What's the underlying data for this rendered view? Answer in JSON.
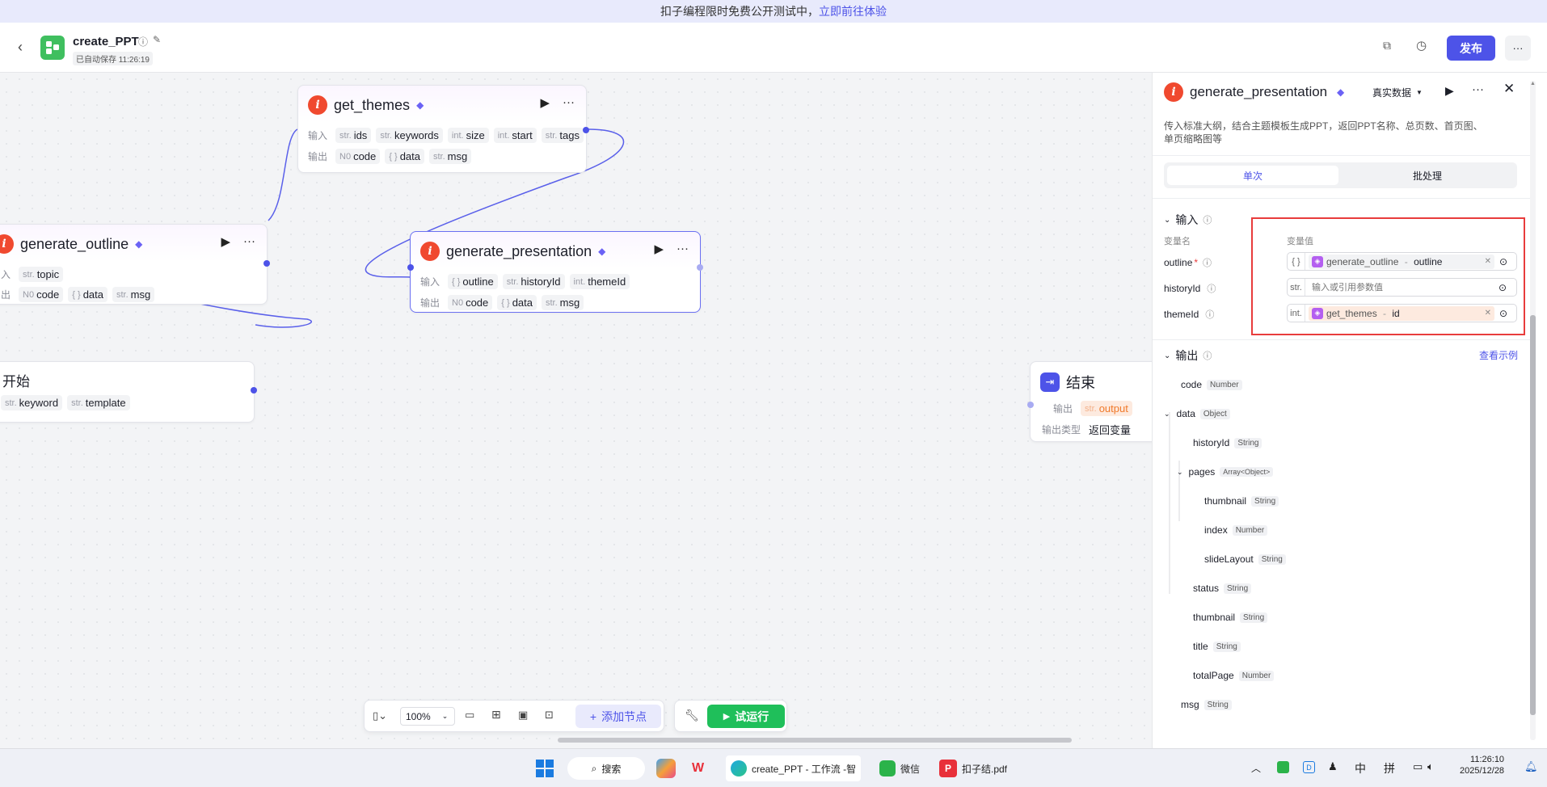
{
  "banner": {
    "text": "扣子编程限时免费公开测试中，",
    "link": "立即前往体验"
  },
  "header": {
    "title": "create_PPT",
    "autosave": "已自动保存 11:26:19",
    "publish_label": "发布",
    "more_label": "···"
  },
  "nodes": {
    "get_themes": {
      "title": "get_themes",
      "input_label": "输入",
      "output_label": "输出",
      "inputs": [
        {
          "type": "str.",
          "name": "ids"
        },
        {
          "type": "str.",
          "name": "keywords"
        },
        {
          "type": "int.",
          "name": "size"
        },
        {
          "type": "int.",
          "name": "start"
        },
        {
          "type": "str.",
          "name": "tags"
        }
      ],
      "outputs": [
        {
          "type": "N0",
          "name": "code"
        },
        {
          "type": "{ }",
          "name": "data"
        },
        {
          "type": "str.",
          "name": "msg"
        }
      ]
    },
    "generate_outline": {
      "title": "generate_outline",
      "input_label": "入",
      "output_label": "出",
      "inputs": [
        {
          "type": "str.",
          "name": "topic"
        }
      ],
      "outputs": [
        {
          "type": "N0",
          "name": "code"
        },
        {
          "type": "{ }",
          "name": "data"
        },
        {
          "type": "str.",
          "name": "msg"
        }
      ]
    },
    "generate_presentation": {
      "title": "generate_presentation",
      "input_label": "输入",
      "output_label": "输出",
      "inputs": [
        {
          "type": "{ }",
          "name": "outline"
        },
        {
          "type": "str.",
          "name": "historyId"
        },
        {
          "type": "int.",
          "name": "themeId"
        }
      ],
      "outputs": [
        {
          "type": "N0",
          "name": "code"
        },
        {
          "type": "{ }",
          "name": "data"
        },
        {
          "type": "str.",
          "name": "msg"
        }
      ]
    },
    "start": {
      "title": "开始",
      "outputs": [
        {
          "type": "str.",
          "name": "keyword"
        },
        {
          "type": "str.",
          "name": "template"
        }
      ]
    },
    "end": {
      "title": "结束",
      "output_label": "输出",
      "output_var": {
        "type": "str.",
        "name": "output"
      },
      "output_type_label": "输出类型",
      "output_type_value": "返回变量"
    }
  },
  "toolbar": {
    "zoom": "100%",
    "add_node_label": "添加节点",
    "test_run_label": "试运行"
  },
  "panel": {
    "title": "generate_presentation",
    "data_mode": "真实数据",
    "description": "传入标准大纲，结合主题模板生成PPT，返回PPT名称、总页数、首页图、单页缩略图等",
    "tabs": [
      "单次",
      "批处理"
    ],
    "input_section": "输入",
    "col_name": "变量名",
    "col_value": "变量值",
    "inputs": [
      {
        "name": "outline",
        "required": "*",
        "type": "{ }",
        "ref_node": "generate_outline",
        "ref_sep": " - ",
        "ref_field": "outline"
      },
      {
        "name": "historyId",
        "type": "str.",
        "placeholder": "输入或引用参数值"
      },
      {
        "name": "themeId",
        "type": "int.",
        "ref_node": "get_themes",
        "ref_sep": " - ",
        "ref_field": "id"
      }
    ],
    "output_section": "输出",
    "view_example": "查看示例",
    "outputs": [
      {
        "name": "code",
        "type": "Number"
      },
      {
        "name": "data",
        "type": "Object"
      },
      {
        "name": "historyId",
        "type": "String"
      },
      {
        "name": "pages",
        "type": "Array<Object>"
      },
      {
        "name": "thumbnail",
        "type": "String"
      },
      {
        "name": "index",
        "type": "Number"
      },
      {
        "name": "slideLayout",
        "type": "String"
      },
      {
        "name": "status",
        "type": "String"
      },
      {
        "name": "thumbnail",
        "type": "String"
      },
      {
        "name": "title",
        "type": "String"
      },
      {
        "name": "totalPage",
        "type": "Number"
      },
      {
        "name": "msg",
        "type": "String"
      }
    ]
  },
  "taskbar": {
    "search_label": "搜索",
    "items": [
      "create_PPT - 工作流 -智",
      "微信",
      "扣子结.pdf"
    ],
    "ime": [
      "中",
      "拼"
    ],
    "time": "11:26:10",
    "date": "2025/12/28"
  },
  "colors": {
    "accent": "#4d53e8",
    "highlight_red": "#e83c3c",
    "run_green": "#1fbf5a"
  }
}
